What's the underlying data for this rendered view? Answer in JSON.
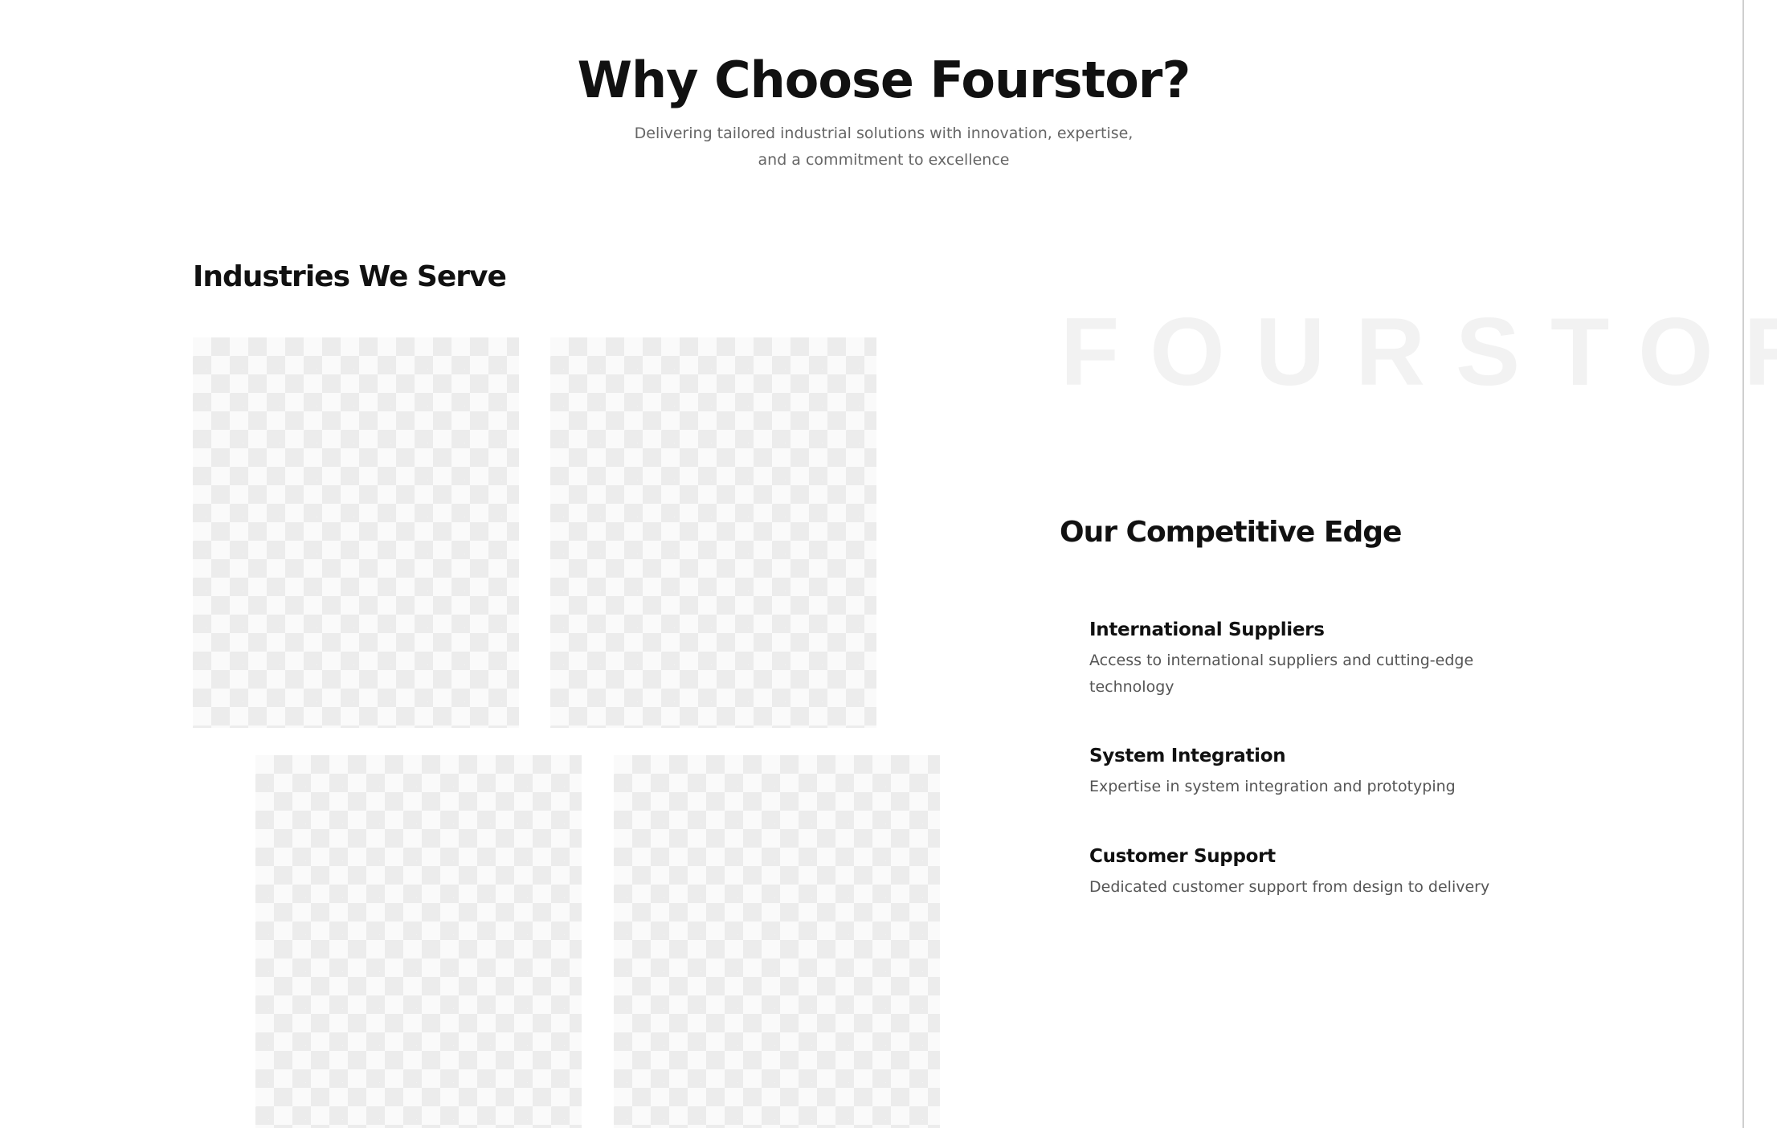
{
  "header": {
    "title": "Why Choose Fourstor?",
    "subtitle": "Delivering tailored industrial solutions with innovation, expertise, and a commitment to excellence"
  },
  "industries": {
    "title": "Industries We Serve",
    "tiles": [
      "image-placeholder",
      "image-placeholder",
      "image-placeholder",
      "image-placeholder"
    ]
  },
  "brand": {
    "watermark": "FOURSTOR"
  },
  "competitive_edge": {
    "title": "Our Competitive Edge",
    "items": [
      {
        "title": "International Suppliers",
        "description": "Access to international suppliers and cutting-edge technology"
      },
      {
        "title": "System Integration",
        "description": "Expertise in system integration and prototyping"
      },
      {
        "title": "Customer Support",
        "description": "Dedicated customer support from design to delivery"
      }
    ]
  },
  "colors": {
    "text": "#111111",
    "muted": "#666666",
    "watermark": "#f2f2f2",
    "placeholder_light": "#fafafa",
    "placeholder_dark": "#ececec"
  }
}
